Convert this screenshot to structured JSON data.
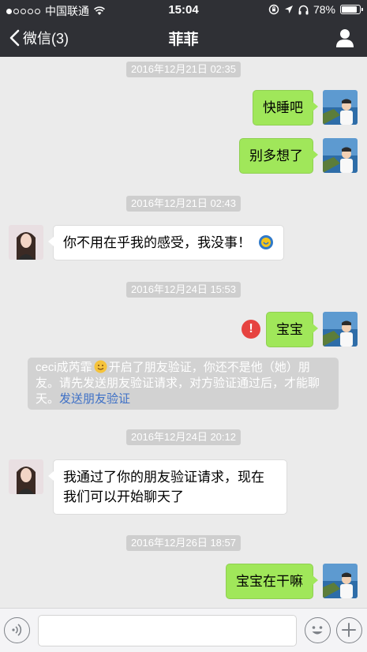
{
  "status_bar": {
    "carrier": "中国联通",
    "time": "15:04",
    "battery": "78%",
    "battery_level": 0.78,
    "icons": [
      "signal-dots-icon",
      "wifi-icon",
      "rotation-lock-icon",
      "location-icon",
      "headphones-icon",
      "battery-icon"
    ]
  },
  "nav": {
    "back_label": "微信(3)",
    "title": "菲菲",
    "profile_icon": "person-icon"
  },
  "messages": [
    {
      "type": "timestamp",
      "text": "2016年12月21日 02:35"
    },
    {
      "type": "message",
      "sender": "me",
      "text": "快睡吧"
    },
    {
      "type": "message",
      "sender": "me",
      "text": "别多想了"
    },
    {
      "type": "timestamp",
      "text": "2016年12月21日 02:43"
    },
    {
      "type": "message",
      "sender": "them",
      "text": "你不用在乎我的感受，我没事！",
      "emoji": "emoji-icon"
    },
    {
      "type": "timestamp",
      "text": "2016年12月24日 15:53"
    },
    {
      "type": "message",
      "sender": "me",
      "text": "宝宝",
      "failed": true,
      "failed_mark": "!"
    },
    {
      "type": "system",
      "text": "ceci成芮霏",
      "emoji": "smile-emoji-icon",
      "text2": "开启了朋友验证，你还不是他（她）朋友。请先发送朋友验证请求，对方验证通过后，才能聊天。",
      "link": "发送朋友验证"
    },
    {
      "type": "timestamp",
      "text": "2016年12月24日 20:12"
    },
    {
      "type": "message",
      "sender": "them",
      "text_line1": "我通过了你的朋友验证请求，现在",
      "text_line2": "我们可以开始聊天了"
    },
    {
      "type": "timestamp",
      "text": "2016年12月26日 18:57"
    },
    {
      "type": "message",
      "sender": "me",
      "text": "宝宝在干嘛"
    }
  ],
  "input_bar": {
    "voice_icon": "voice-icon",
    "emoji_icon": "emoji-icon",
    "more_icon": "plus-icon",
    "text_value": ""
  },
  "colors": {
    "nav_bg": "#2f3035",
    "chat_bg": "#ebebeb",
    "my_bubble": "#a0e75a",
    "their_bubble": "#ffffff",
    "timestamp_bg": "#cecece",
    "error": "#e64340",
    "link": "#3e70c6"
  }
}
